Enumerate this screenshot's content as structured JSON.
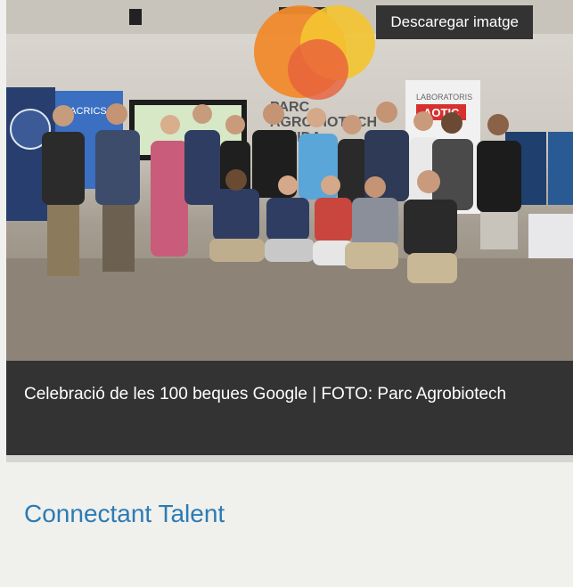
{
  "figure": {
    "download_label": "Descaregar imatge",
    "caption": "Celebració de les 100 beques Google | FOTO: Parc Agrobiotech",
    "photo": {
      "backdrop_text": [
        "PARC",
        "AGROBIOTECH",
        "LLEIDA"
      ],
      "banner_right": [
        "LABORATORIS",
        "AOTIC"
      ],
      "banner_left": "MACRICS",
      "colors": {
        "wall": "#dcd9d3",
        "floor": "#8a8073",
        "logo_orange": "#f08a2c",
        "logo_yellow": "#f4c430"
      }
    }
  },
  "section": {
    "title": "Connectant Talent",
    "accent_color": "#2b7bb5"
  }
}
